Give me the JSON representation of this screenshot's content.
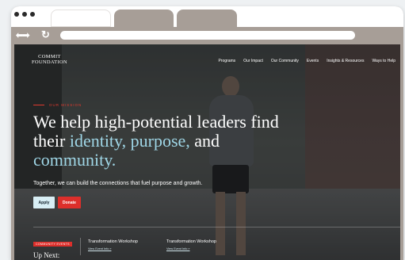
{
  "browser": {
    "tabs": [
      "",
      "",
      ""
    ]
  },
  "site": {
    "logo": {
      "line1": "COMMIT",
      "line2": "FOUNDATION"
    },
    "nav": [
      "Programs",
      "Our Impact",
      "Our Community",
      "Events",
      "Insights & Resources",
      "Ways to Help"
    ],
    "hero": {
      "eyebrow": "OUR MISSION",
      "headline_part1": "We help high-potential leaders find their ",
      "headline_accent1": "identity,",
      "headline_accent2": "purpose,",
      "headline_part2": " and ",
      "headline_accent3": "community.",
      "subtext": "Together, we can build the connections that fuel purpose and growth.",
      "apply_label": "Apply",
      "donate_label": "Donate"
    },
    "up_next": {
      "badge": "COMMUNITY EVENTS",
      "title": "Up Next:",
      "events": [
        {
          "name": "Transformation Workshop",
          "link": "View Event Info »"
        },
        {
          "name": "Transformation Workshop",
          "link": "View Event Info »"
        }
      ]
    }
  },
  "colors": {
    "accent_red": "#dd2f2b",
    "accent_blue": "#9fd6e6"
  },
  "icons": [
    "back-arrow-icon",
    "forward-arrow-icon",
    "reload-icon"
  ]
}
